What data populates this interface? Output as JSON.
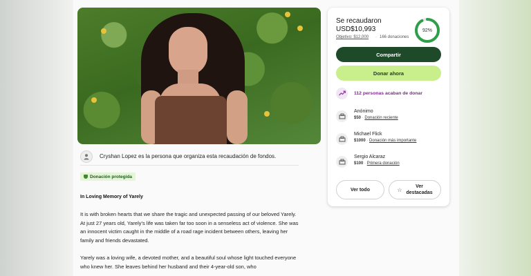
{
  "organizer": {
    "text": "Cryshan Lopez es la persona que organiza esta recaudación de fondos."
  },
  "badge": {
    "protected": "Donación protegida"
  },
  "story": {
    "title": "In Loving Memory of Yarely",
    "p1": "It is with broken hearts that we share the tragic and unexpected passing of our beloved Yarely. At just 27 years old, Yarely's life was taken far too soon in a senseless act of violence. She was an innocent victim caught in the middle of a road rage incident between others, leaving her family and friends devastated.",
    "p2": "Yarely was a loving wife, a devoted mother, and a beautiful soul whose light touched everyone who knew her. She leaves behind her husband and their 4-year-old son, who"
  },
  "campaign": {
    "raised_label": "Se recaudaron",
    "raised_amount": "USD$10,993",
    "goal": "Objetivo: $12,000",
    "separator": "·",
    "donations_count": "166 donaciones",
    "progress_percent": 92,
    "progress_label": "92%"
  },
  "actions": {
    "share": "Compartir",
    "donate": "Donar ahora",
    "see_all": "Ver todo",
    "top_line1": "Ver",
    "top_line2": "destacadas"
  },
  "recent": {
    "text": "112 personas acaban de donar"
  },
  "donors": [
    {
      "name": "Anónimo",
      "amount": "$50",
      "sep": "·",
      "tag": "Donación reciente"
    },
    {
      "name": "Michael Flick",
      "amount": "$1000",
      "sep": "·",
      "tag": "Donación más importante"
    },
    {
      "name": "Sergio Alcaraz",
      "amount": "$100",
      "sep": "·",
      "tag": "Primera donación"
    }
  ],
  "colors": {
    "accent_dark": "#1e4a2a",
    "accent_light": "#c9ef8c",
    "progress": "#2e9e4a",
    "recent_text": "#7b2a8a"
  },
  "icons": {
    "organizer": "person-icon",
    "protected": "shield-icon",
    "recent": "trending-up-icon",
    "donor": "donation-box-icon",
    "top": "sparkle-icon"
  }
}
